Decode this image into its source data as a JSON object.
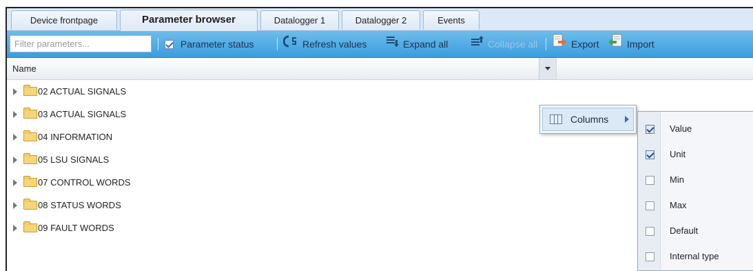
{
  "tabs": [
    {
      "label": "Device frontpage",
      "active": false
    },
    {
      "label": "Parameter browser",
      "active": true
    },
    {
      "label": "Datalogger 1",
      "active": false
    },
    {
      "label": "Datalogger 2",
      "active": false
    },
    {
      "label": "Events",
      "active": false
    }
  ],
  "toolbar": {
    "filter_placeholder": "Filter parameters...",
    "parameter_status_label": "Parameter status",
    "parameter_status_checked": true,
    "refresh_label": "Refresh values",
    "expand_label": "Expand all",
    "collapse_label": "Collapse all",
    "export_label": "Export",
    "import_label": "Import"
  },
  "grid": {
    "column_name": "Name",
    "rows": [
      "02 ACTUAL SIGNALS",
      "03 ACTUAL SIGNALS",
      "04 INFORMATION",
      "05 LSU SIGNALS",
      "07 CONTROL WORDS",
      "08 STATUS WORDS",
      "09 FAULT WORDS"
    ]
  },
  "column_menu": {
    "label": "Columns",
    "items": [
      {
        "label": "Value",
        "checked": true
      },
      {
        "label": "Unit",
        "checked": true
      },
      {
        "label": "Min",
        "checked": false
      },
      {
        "label": "Max",
        "checked": false
      },
      {
        "label": "Default",
        "checked": false
      },
      {
        "label": "Internal type",
        "checked": false
      }
    ]
  },
  "colors": {
    "toolbar_blue": "#3a9ddf",
    "tab_bar": "#dbe8f7",
    "folder": "#f6d67a"
  }
}
